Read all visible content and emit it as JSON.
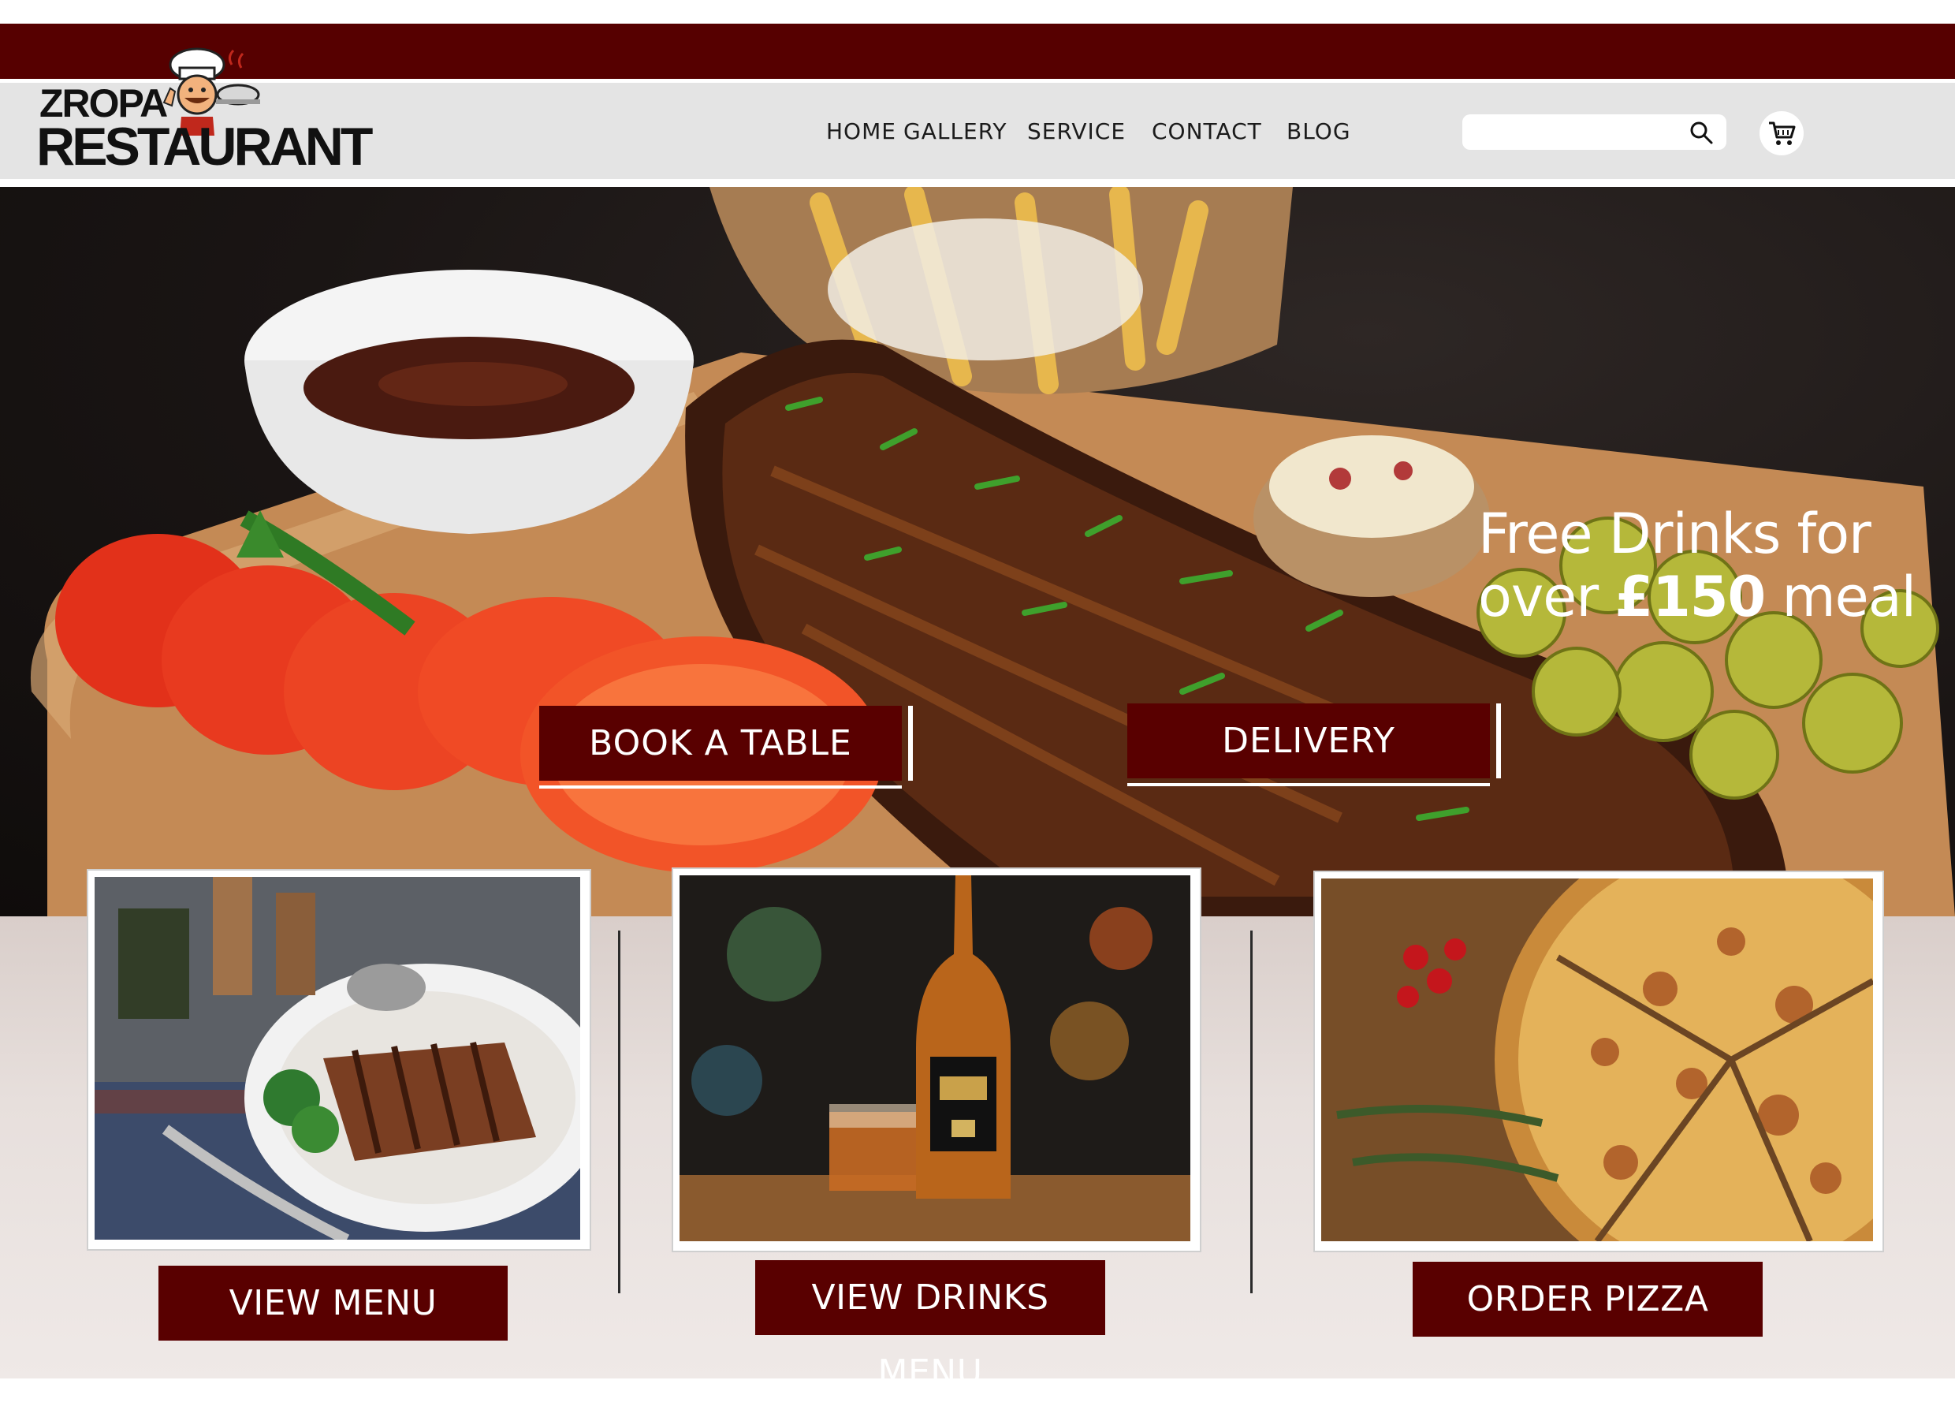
{
  "brand": {
    "name_top": "ZROPA",
    "name_bottom": "RESTAURANT",
    "color": "#560000"
  },
  "nav": {
    "items": [
      "HOME",
      "GALLERY",
      "SERVICE",
      "CONTACT",
      "BLOG"
    ]
  },
  "search": {
    "value": "",
    "placeholder": "",
    "icon": "search-icon"
  },
  "cart": {
    "icon": "cart-icon"
  },
  "hero": {
    "promo_line1": "Free Drinks for",
    "promo_line2_pre": "over ",
    "promo_line2_bold": "£150",
    "promo_line2_post": " meal",
    "book_label": "BOOK A TABLE",
    "delivery_label": "DELIVERY"
  },
  "cards": [
    {
      "button_label": "VIEW MENU"
    },
    {
      "button_label": "VIEW DRINKS MENU"
    },
    {
      "button_label": "ORDER PIZZA"
    }
  ],
  "colors": {
    "accent": "#590000",
    "nav_bg": "#e4e4e4",
    "text_light": "#ffffff"
  }
}
